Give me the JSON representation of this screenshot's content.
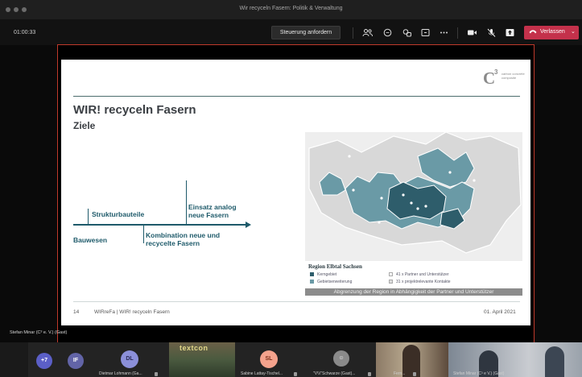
{
  "window": {
    "title": "Wir recyceln Fasern: Politik & Verwaltung"
  },
  "toolbar": {
    "timer": "01:00:33",
    "request_control_label": "Steuerung anfordern",
    "leave_label": "Verlassen",
    "icons": [
      "participants-icon",
      "chat-icon",
      "reactions-icon",
      "breakout-rooms-icon",
      "more-icon",
      "camera-icon",
      "mic-off-icon",
      "share-icon"
    ]
  },
  "slide": {
    "title": "WIR! recyceln Fasern",
    "subtitle": "Ziele",
    "logo_mark": "C",
    "logo_sup": "3",
    "logo_words": "carbon concrete composite",
    "diagram": {
      "strukturbauteile": "Strukturbauteile",
      "einsatz": "Einsatz analog neue Fasern",
      "bauwesen": "Bauwesen",
      "kombination": "Kombination neue und recycelte Fasern"
    },
    "map": {
      "legend_title": "Region Elbtal Sachsen",
      "legend_kerngebiet": "Kerngebiet",
      "legend_erweiterung": "Gebietserweiterung",
      "legend_partner": "41 x Partner und Unterstützer",
      "legend_kontakte": "31 x projektrelevante Kontakte",
      "caption": "Abgrenzung der Region in Abhängigkeit der Partner und Unterstützer",
      "colors": {
        "core": "#2e5d6b",
        "extension": "#6a9aa6",
        "background": "#d5d5d5"
      }
    },
    "footer": {
      "page": "14",
      "text": "WIRreFa | WIR! recyceln Fasern",
      "date": "01. April 2021"
    }
  },
  "presenter": "Stefan Minar (C³ e. V.) (Gast)",
  "participants": {
    "overflow": "+7",
    "tiles": [
      {
        "initials": "IF",
        "name": ""
      },
      {
        "initials": "DL",
        "name": "Dietmar Lohmann (Ga..."
      },
      {
        "initials": "",
        "name": "textcon"
      },
      {
        "initials": "SL",
        "name": "Sabine Lattay-Tischel..."
      },
      {
        "initials": "",
        "name": "\"V\\\\\\\"Schwarze (Gast)..."
      },
      {
        "initials": "",
        "name": "Fern..."
      },
      {
        "initials": "",
        "name": "Stefan Minar (C³ e V.) (Gast)"
      }
    ]
  }
}
